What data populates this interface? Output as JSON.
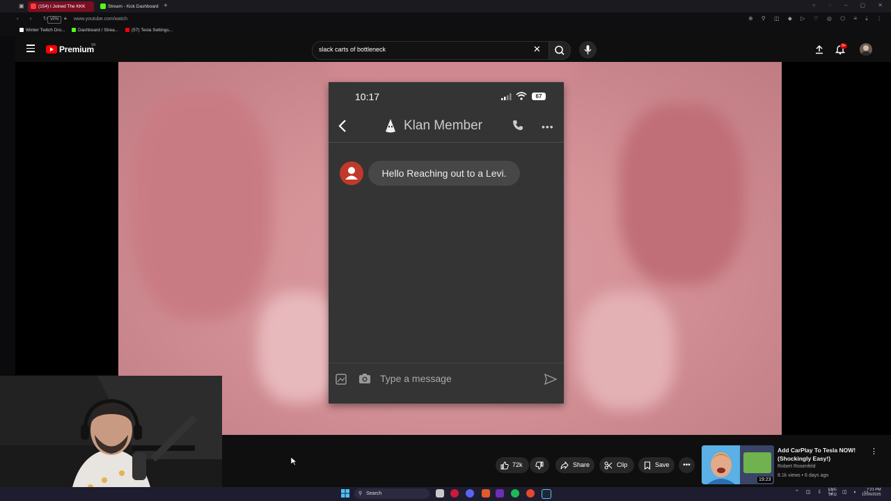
{
  "browser": {
    "tabs": [
      {
        "label": "(154) I Joined The KKK",
        "active": true
      },
      {
        "label": "Stream - Kick Dashboard",
        "active": false
      }
    ],
    "vpn_label": "VPN",
    "url": "www.youtube.com/watch",
    "bookmarks": [
      "Winter Twitch Dro...",
      "Dashboard / Strea...",
      "(57) Tesla Settings..."
    ]
  },
  "youtube": {
    "brand": "Premium",
    "region": "SK",
    "search_query": "slack carts of bottleneck",
    "notifications": "9+"
  },
  "video_frame": {
    "phone_time": "10:17",
    "battery": "67",
    "contact_name": "Klan Member",
    "message": "Hello Reaching out to a Levi.",
    "composer_placeholder": "Type a message"
  },
  "actions": {
    "likes": "72k",
    "share": "Share",
    "clip": "Clip",
    "save": "Save"
  },
  "recommendation": {
    "title": "Add CarPlay To Tesla NOW! (Shockingly Easy!)",
    "channel": "Robert Rosenfeld",
    "meta": "8.1k views • 6 days ago",
    "duration": "19:23"
  },
  "taskbar": {
    "search": "Search",
    "lang_line1": "ENG",
    "lang_line2": "SKQ",
    "time": "7:21 PM",
    "date": "12/26/2025"
  },
  "colors": {
    "youtube_red": "#ff0000",
    "active_tab": "#7a0f22",
    "video_pink": "#d59398",
    "phone_bg": "#343434",
    "taskbar": "#1e1d30"
  }
}
